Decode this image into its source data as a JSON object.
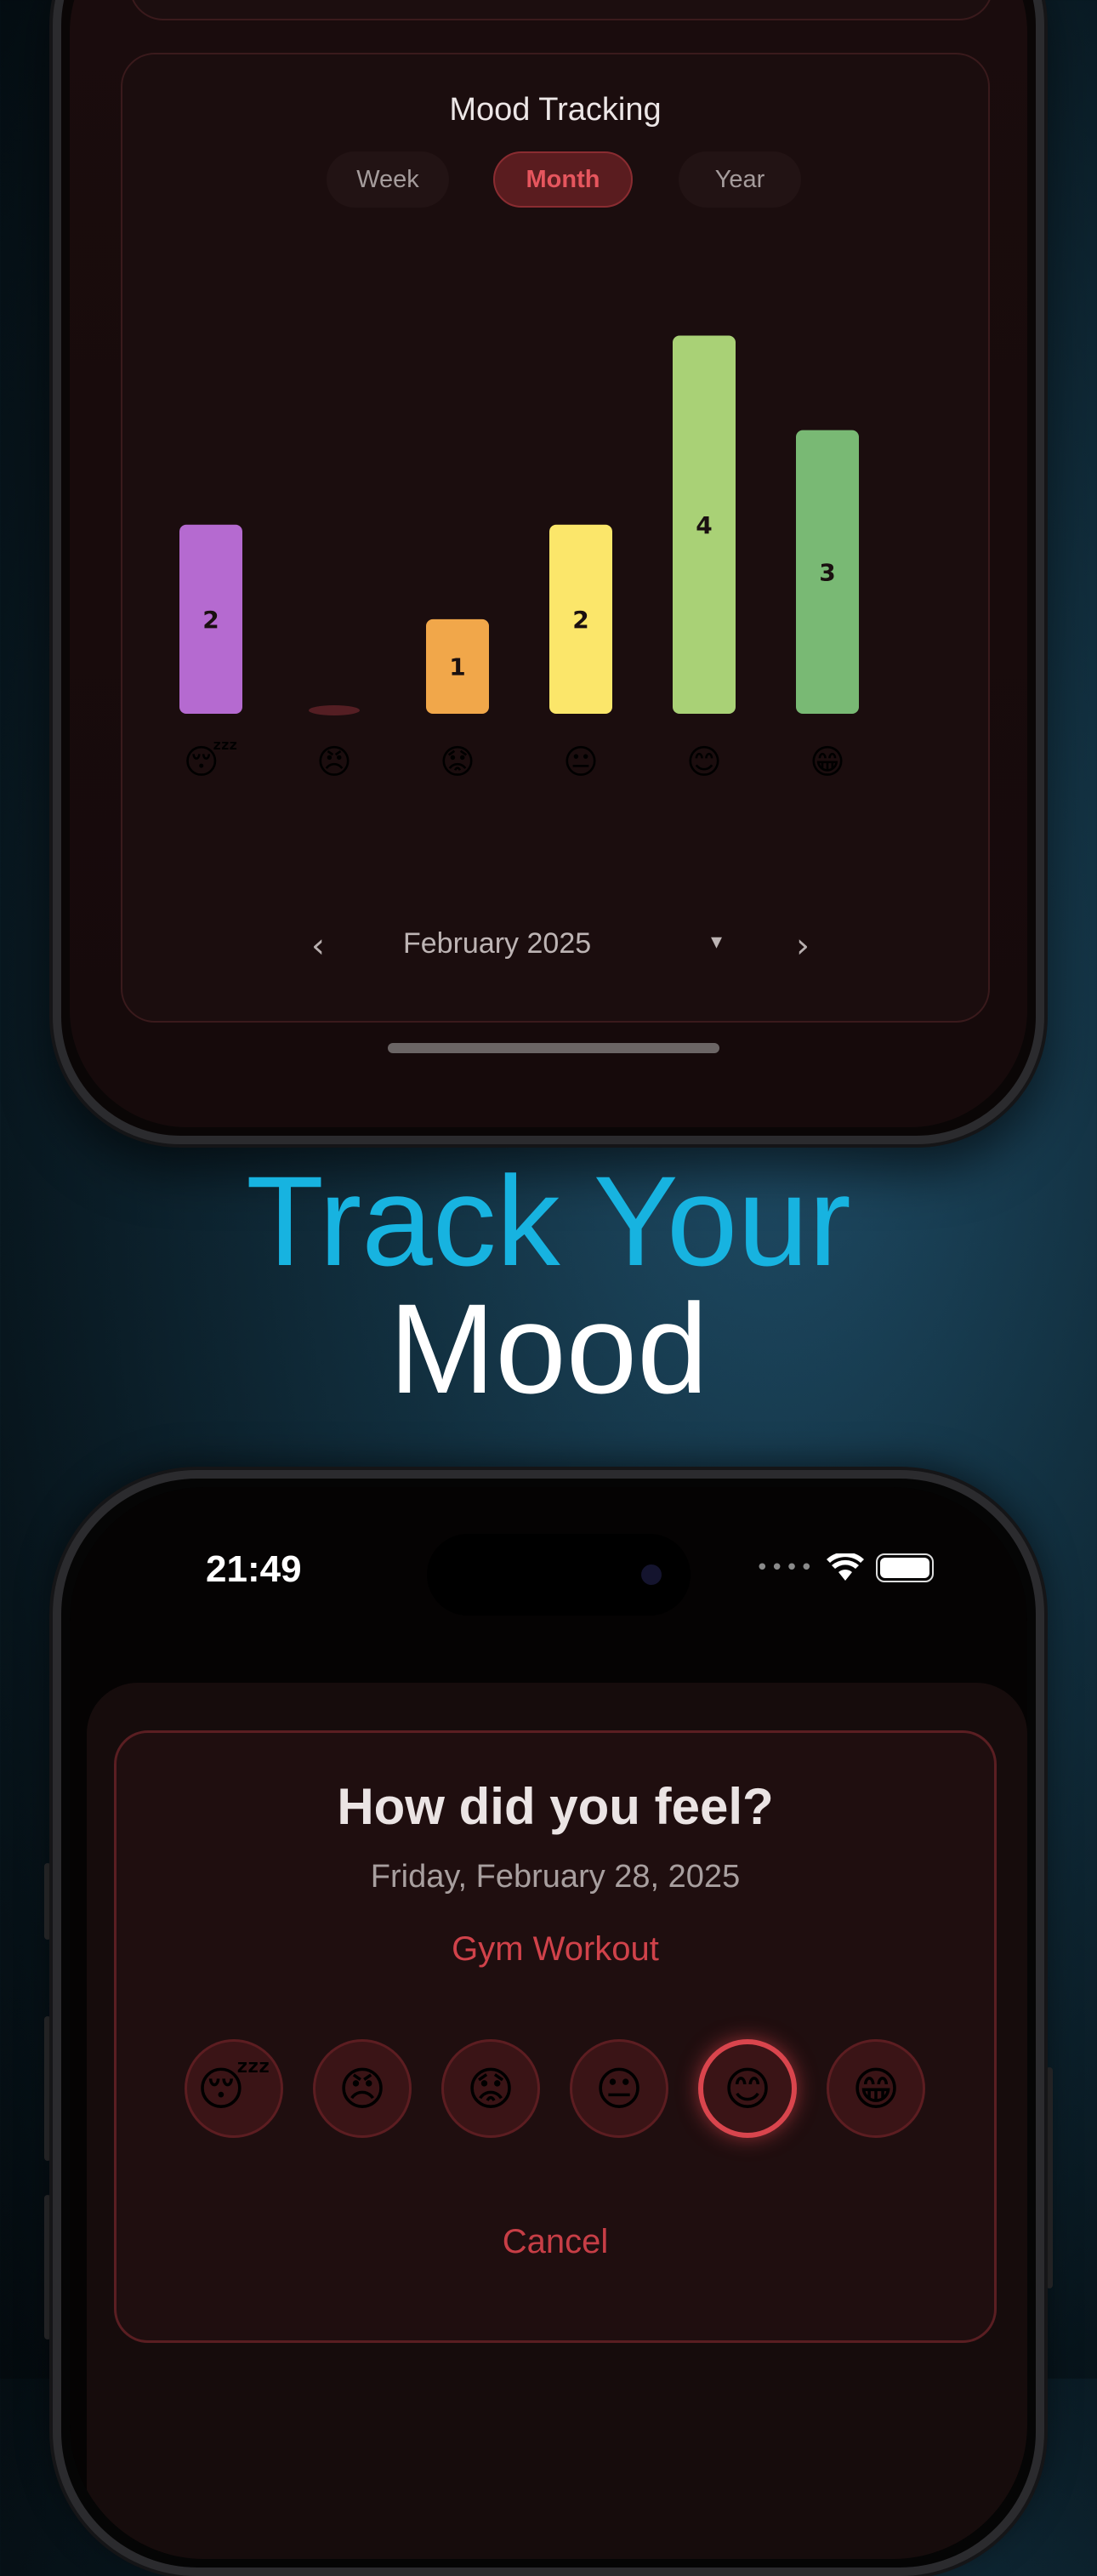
{
  "top_screen": {
    "mood_tracking": {
      "title": "Mood Tracking",
      "tabs": [
        {
          "label": "Week",
          "selected": false
        },
        {
          "label": "Month",
          "selected": true
        },
        {
          "label": "Year",
          "selected": false
        }
      ],
      "period_label": "February 2025"
    }
  },
  "chart_data": {
    "type": "bar",
    "categories": [
      "😴",
      "😠",
      "😟",
      "😐",
      "😊",
      "😁"
    ],
    "values": [
      2,
      0,
      1,
      2,
      4,
      3
    ],
    "colors": [
      "#b56ad0",
      "#c0404a",
      "#f1a74a",
      "#fbe66a",
      "#a9d176",
      "#79b974"
    ],
    "ylim": [
      0,
      4.5
    ]
  },
  "headline": {
    "line1": "Track Your",
    "line2": "Mood",
    "line1_color": "#17b3e0",
    "line2_color": "#ffffff"
  },
  "bottom_screen": {
    "status_bar": {
      "time": "21:49"
    },
    "dialog": {
      "title": "How did you feel?",
      "date": "Friday, February 28, 2025",
      "event": "Gym Workout",
      "moods": [
        {
          "emoji": "😴",
          "selected": false
        },
        {
          "emoji": "😠",
          "selected": false
        },
        {
          "emoji": "😟",
          "selected": false
        },
        {
          "emoji": "😐",
          "selected": false
        },
        {
          "emoji": "😊",
          "selected": true
        },
        {
          "emoji": "😁",
          "selected": false
        }
      ],
      "cancel_label": "Cancel"
    }
  }
}
